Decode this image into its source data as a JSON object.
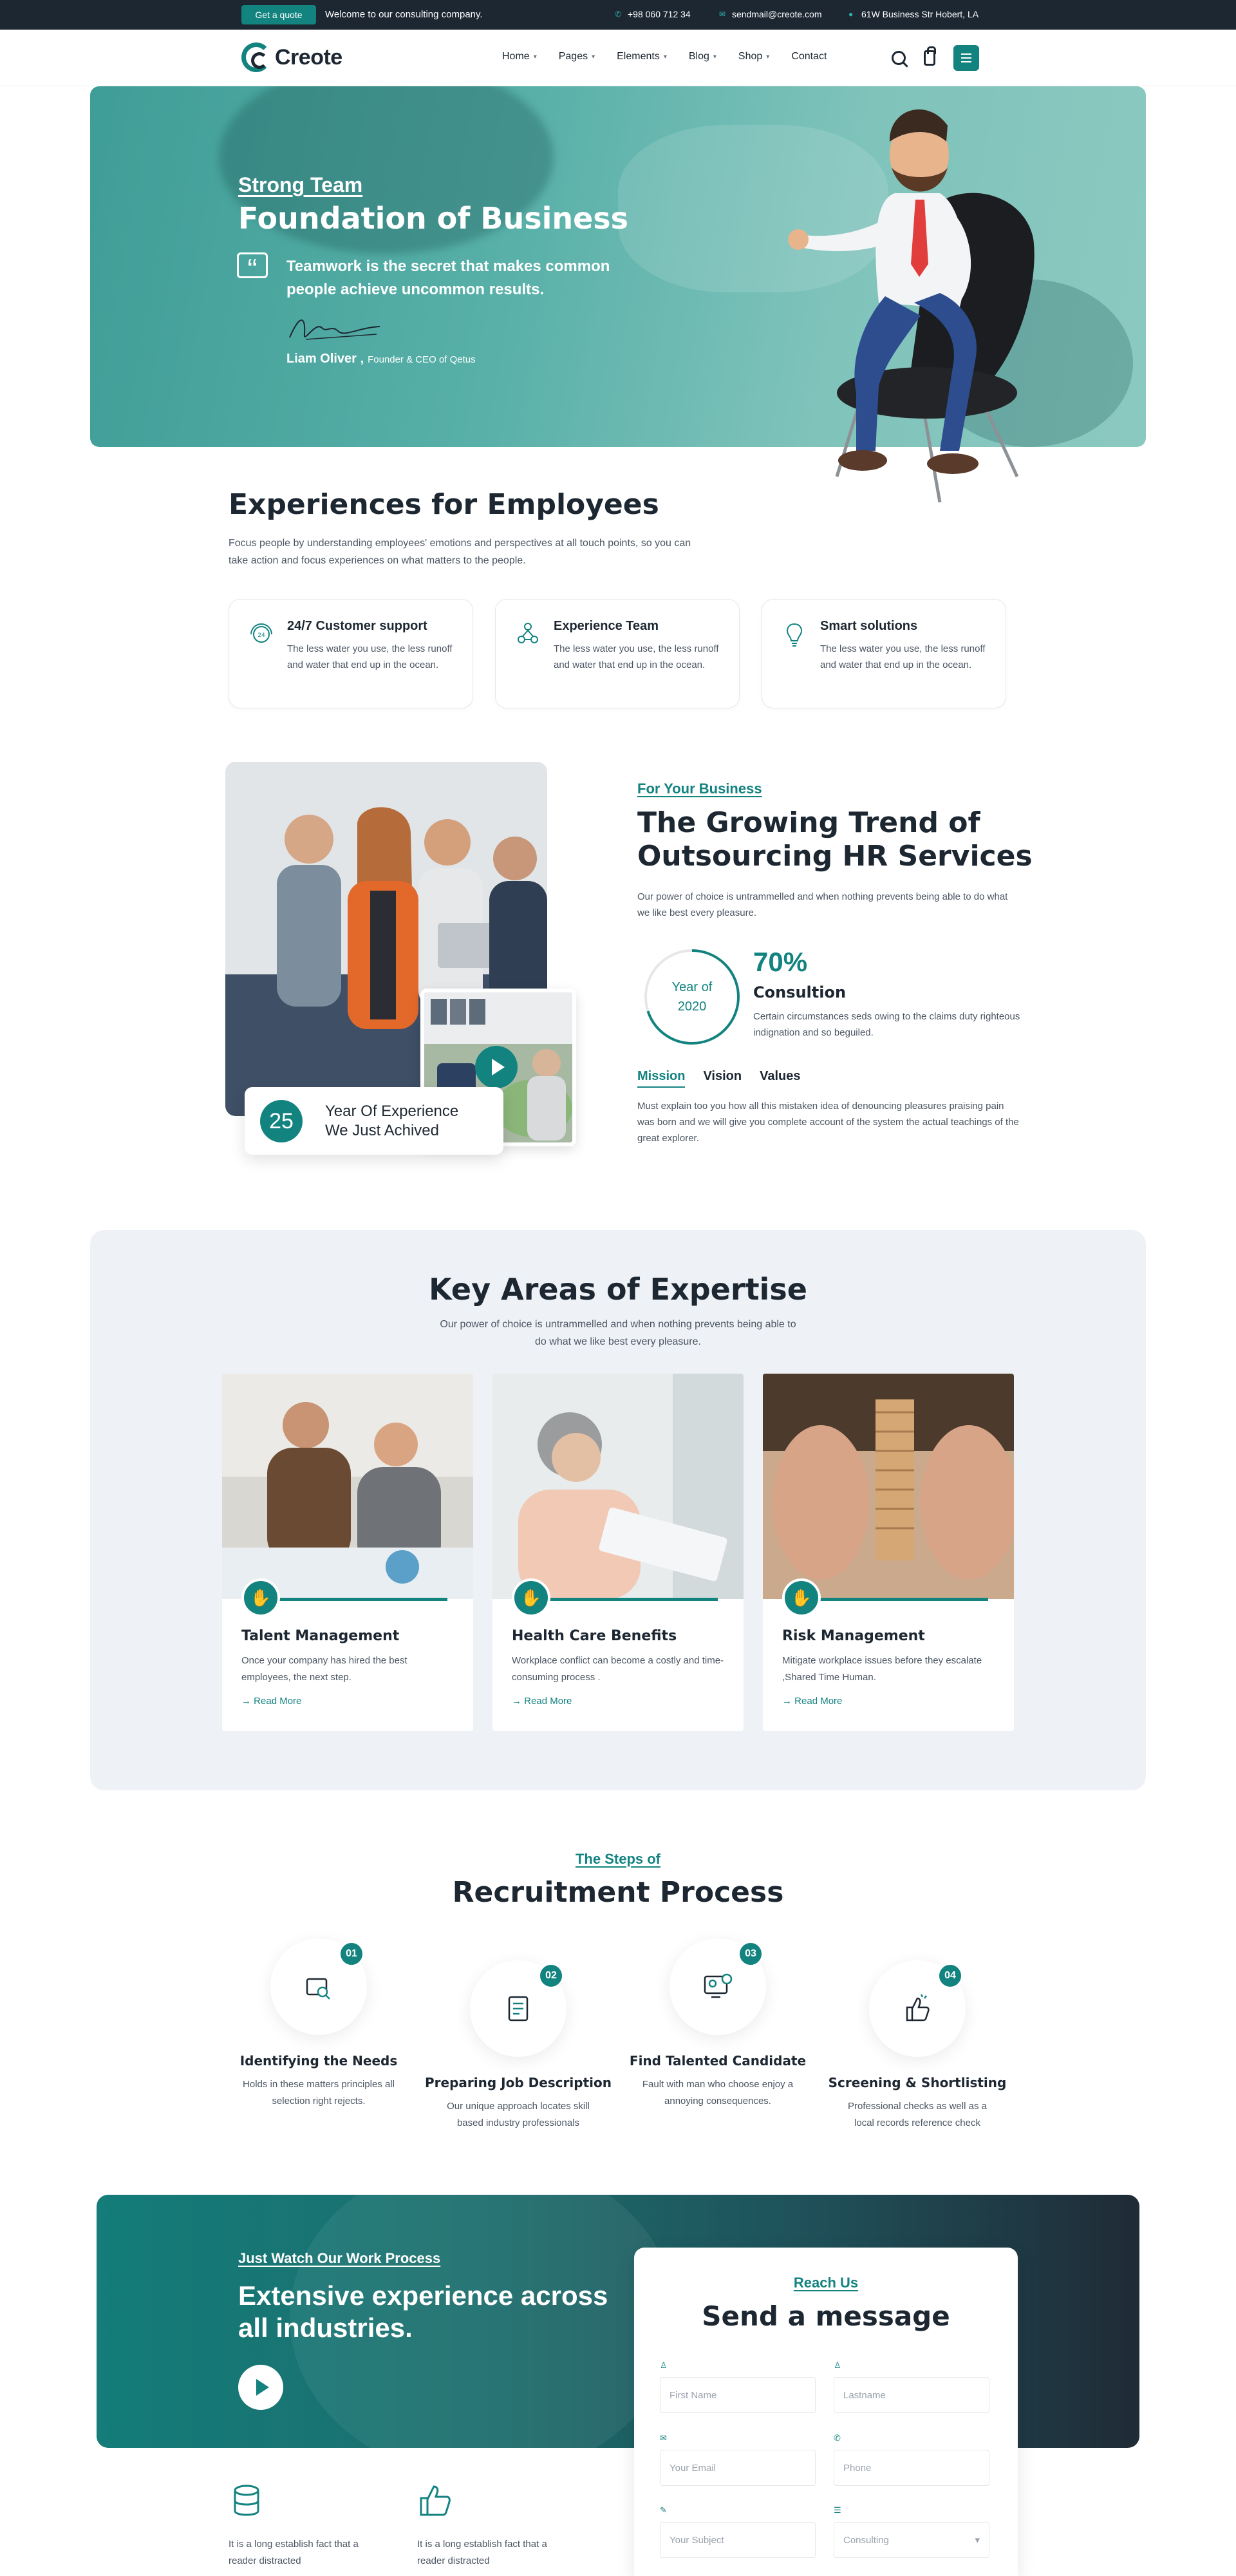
{
  "topbar": {
    "quote_button": "Get a quote",
    "welcome": "Welcome to our consulting company.",
    "phone": "+98 060 712 34",
    "email": "sendmail@creote.com",
    "address": "61W Business Str Hobert, LA"
  },
  "header": {
    "logo": "Creote",
    "nav": [
      "Home",
      "Pages",
      "Elements",
      "Blog",
      "Shop",
      "Contact"
    ]
  },
  "hero": {
    "eyebrow": "Strong Team",
    "title": "Foundation of Business",
    "quote": "Teamwork is the secret that makes common people achieve uncommon results.",
    "author_name": "Liam Oliver ,",
    "author_role": "Founder & CEO of Qetus"
  },
  "experiences": {
    "title": "Experiences for Employees",
    "text": "Focus people by understanding employees' emotions and perspectives at all touch points, so you can take action and focus experiences on what matters to the people.",
    "features": [
      {
        "title": "24/7 Customer support",
        "text": "The less water you use, the less runoff and water that end up in the ocean.",
        "icon": "support-icon"
      },
      {
        "title": "Experience Team",
        "text": "The less water you use, the less runoff and water that end up in the ocean.",
        "icon": "team-icon"
      },
      {
        "title": "Smart solutions",
        "text": "The less water you use, the less runoff and water that end up in the ocean.",
        "icon": "bulb-icon"
      }
    ]
  },
  "about": {
    "years_number": "25",
    "years_label_1": "Year Of Experience",
    "years_label_2": "We Just Achived",
    "eyebrow": "For Your Business",
    "title": "The Growing Trend of Outsourcing HR Services",
    "text": "Our power of choice is untrammelled and when nothing prevents being able to do what we like best every pleasure.",
    "year_circle_1": "Year of",
    "year_circle_2": "2020",
    "percent": "70%",
    "percent_label": "Consultion",
    "percent_text": "Certain circumstances seds owing to the claims duty righteous indignation and so beguiled.",
    "tabs": [
      "Mission",
      "Vision",
      "Values"
    ],
    "tab_text": "Must explain too you how all this mistaken idea of denouncing pleasures praising pain was born and we will give you complete account of the system the actual teachings of the great explorer."
  },
  "expertise": {
    "title": "Key Areas of Expertise",
    "text": "Our power of choice is untrammelled and when nothing prevents being able to do what we like best every pleasure.",
    "cards": [
      {
        "title": "Talent Management",
        "text": "Once your company has hired the best employees, the next step.",
        "link": "Read More"
      },
      {
        "title": "Health Care Benefits",
        "text": "Workplace conflict can become a costly and time-consuming process .",
        "link": "Read More"
      },
      {
        "title": "Risk Management",
        "text": "Mitigate workplace issues before they escalate ,Shared Time Human.",
        "link": "Read More"
      }
    ]
  },
  "steps": {
    "eyebrow": "The Steps of",
    "title": "Recruitment Process",
    "items": [
      {
        "num": "01",
        "title": "Identifying the Needs",
        "text": "Holds in these matters principles all selection right rejects."
      },
      {
        "num": "02",
        "title": "Preparing Job Description",
        "text": "Our unique approach locates skill based industry professionals"
      },
      {
        "num": "03",
        "title": "Find Talented Candidate",
        "text": "Fault with man who choose enjoy a annoying consequences."
      },
      {
        "num": "04",
        "title": "Screening & Shortlisting",
        "text": "Professional checks as well as a local records reference check"
      }
    ]
  },
  "work": {
    "eyebrow": "Just Watch Our Work Process",
    "title": "Extensive experience across all industries.",
    "bottom_items": [
      {
        "text": "It is a long establish fact that a reader distracted"
      },
      {
        "text": "It is a long establish fact that a reader distracted"
      }
    ]
  },
  "form": {
    "eyebrow": "Reach Us",
    "title": "Send a message",
    "first_name": "First Name",
    "last_name": "Lastname",
    "email": "Your Email",
    "phone": "Phone",
    "subject": "Your Subject",
    "select": "Consulting"
  },
  "colors": {
    "accent": "#138380",
    "dark": "#1d2732",
    "light_bg": "#eef1f5"
  }
}
